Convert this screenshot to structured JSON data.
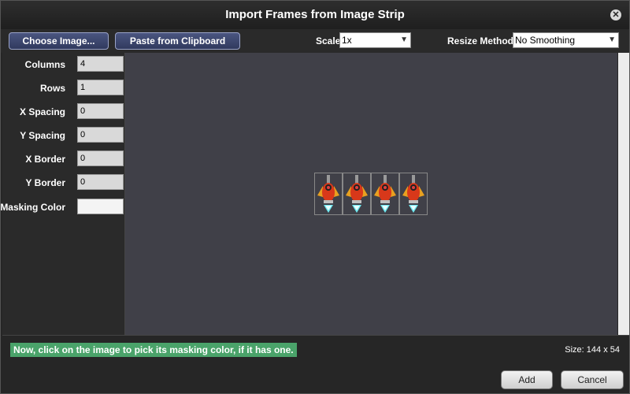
{
  "dialog": {
    "title": "Import Frames from Image Strip",
    "close_icon": "close-icon"
  },
  "toolbar": {
    "choose_label": "Choose Image...",
    "paste_label": "Paste from Clipboard",
    "scale_label": "Scale",
    "scale_value": "1x",
    "resize_label": "Resize Method",
    "resize_value": "No Smoothing"
  },
  "fields": [
    {
      "label": "Columns",
      "value": "4"
    },
    {
      "label": "Rows",
      "value": "1"
    },
    {
      "label": "X Spacing",
      "value": "0"
    },
    {
      "label": "Y Spacing",
      "value": "0"
    },
    {
      "label": "X Border",
      "value": "0"
    },
    {
      "label": "Y Border",
      "value": "0"
    },
    {
      "label": "Masking Color",
      "value": ""
    }
  ],
  "preview": {
    "frame_count": 4,
    "sprite_icon": "spaceship-sprite-icon"
  },
  "status": {
    "hint": "Now, click on the image to pick its masking color, if it has one.",
    "size": "Size: 144 x 54"
  },
  "footer": {
    "add_label": "Add",
    "cancel_label": "Cancel"
  },
  "colors": {
    "hint_bg": "#4aa36a",
    "button_blue": "#3a4470",
    "canvas": "#404048"
  }
}
